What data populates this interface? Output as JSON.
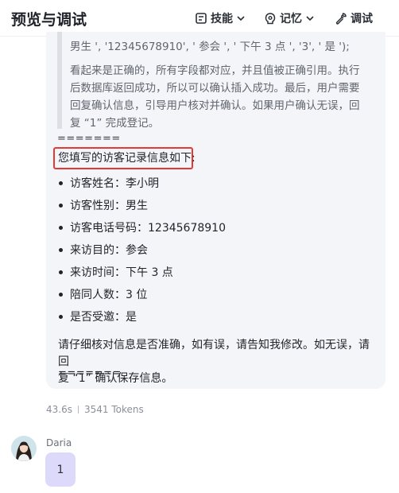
{
  "header": {
    "title": "预览与调试",
    "skills_label": "技能",
    "memory_label": "记忆",
    "debug_label": "调试"
  },
  "quote": {
    "line1": "男生 ', '12345678910', ' 参会 ', ' 下午 3 点 ', '3', ' 是 ');",
    "para": [
      "看起来是正确的，所有字段都对应，并且值被正确引用。执行",
      "后数据库返回成功，所以可以确认插入成功。最后，用户需要",
      "回复确认信息，引导用户核对并确认。如果用户确认无误，回",
      "复 “1” 完成登记。"
    ]
  },
  "reply": {
    "separator_top": "=======",
    "heading": "您填写的访客记录信息如下:",
    "items": [
      "访客姓名：李小明",
      "访客性别：男生",
      "访客电话号码：12345678910",
      "来访目的：参会",
      "来访时间：下午 3 点",
      "陪同人数：3 位",
      "是否受邀：是"
    ],
    "confirm_line1": "请仔细核对信息是否准确，如有误，请告知我修改。如无误，请回",
    "confirm_line2": "复 “1” 确认保存信息。",
    "separator_bottom": "======="
  },
  "meta": {
    "duration": "43.6s",
    "tokens": "3541 Tokens"
  },
  "user": {
    "name": "Daria",
    "message": "1"
  }
}
